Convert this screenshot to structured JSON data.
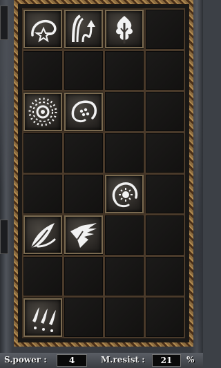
{
  "skill_grid": {
    "columns": 4,
    "rows": 8,
    "slots": [
      {
        "row": 0,
        "col": 0,
        "icon": "swirl-star-icon"
      },
      {
        "row": 0,
        "col": 1,
        "icon": "updraft-arrow-icon"
      },
      {
        "row": 0,
        "col": 2,
        "icon": "tree-spirit-icon"
      },
      {
        "row": 2,
        "col": 0,
        "icon": "radiant-ring-icon"
      },
      {
        "row": 2,
        "col": 1,
        "icon": "crescent-dots-icon"
      },
      {
        "row": 4,
        "col": 2,
        "icon": "sun-crescent-icon"
      },
      {
        "row": 5,
        "col": 0,
        "icon": "leaf-blade-icon"
      },
      {
        "row": 5,
        "col": 1,
        "icon": "wing-feather-icon"
      },
      {
        "row": 7,
        "col": 0,
        "icon": "claw-marks-icon"
      }
    ]
  },
  "stats": {
    "spell_power_label": "S.power :",
    "spell_power_value": "4",
    "magic_resist_label": "M.resist :",
    "magic_resist_value": "21",
    "percent_sign": "%"
  },
  "colors": {
    "frame": "#8a6a3e",
    "slot_background": "#1a1816",
    "icon_glyph": "#f2f2f2",
    "stone": "#3c4046"
  }
}
